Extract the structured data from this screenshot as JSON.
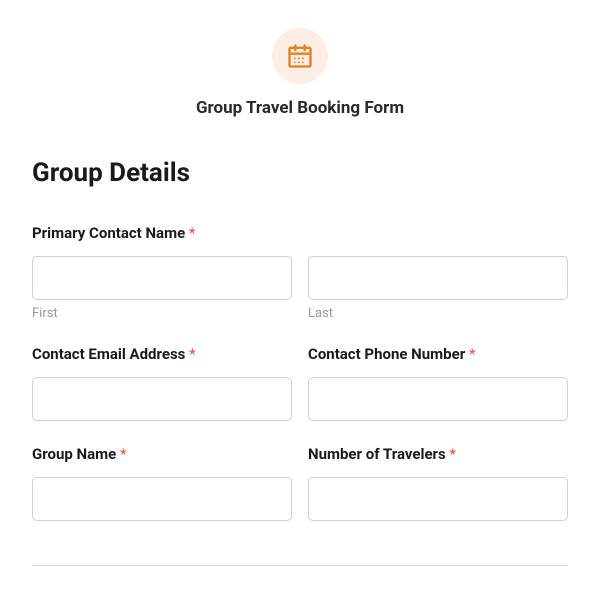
{
  "header": {
    "title": "Group Travel Booking Form"
  },
  "section": {
    "title": "Group Details"
  },
  "fields": {
    "primaryContactName": {
      "label": "Primary Contact Name",
      "firstSubLabel": "First",
      "lastSubLabel": "Last"
    },
    "contactEmail": {
      "label": "Contact Email Address"
    },
    "contactPhone": {
      "label": "Contact Phone Number"
    },
    "groupName": {
      "label": "Group Name"
    },
    "numberOfTravelers": {
      "label": "Number of Travelers"
    }
  },
  "required_marker": "*"
}
